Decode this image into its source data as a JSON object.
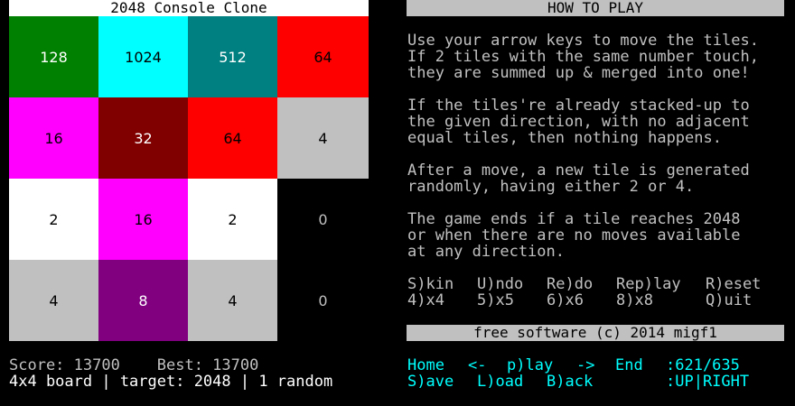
{
  "title": "2048 Console Clone",
  "board": {
    "tiles": [
      {
        "value": "128",
        "bg": "#008000",
        "fg": "#ffffff"
      },
      {
        "value": "1024",
        "bg": "#00ffff",
        "fg": "#000000"
      },
      {
        "value": "512",
        "bg": "#008080",
        "fg": "#ffffff"
      },
      {
        "value": "64",
        "bg": "#ff0000",
        "fg": "#000000"
      },
      {
        "value": "16",
        "bg": "#ff00ff",
        "fg": "#000000"
      },
      {
        "value": "32",
        "bg": "#800000",
        "fg": "#ffffff"
      },
      {
        "value": "64",
        "bg": "#ff0000",
        "fg": "#000000"
      },
      {
        "value": "4",
        "bg": "#c0c0c0",
        "fg": "#000000"
      },
      {
        "value": "2",
        "bg": "#ffffff",
        "fg": "#000000"
      },
      {
        "value": "16",
        "bg": "#ff00ff",
        "fg": "#000000"
      },
      {
        "value": "2",
        "bg": "#ffffff",
        "fg": "#000000"
      },
      {
        "value": "0",
        "bg": "#000000",
        "fg": "#c0c0c0"
      },
      {
        "value": "4",
        "bg": "#c0c0c0",
        "fg": "#000000"
      },
      {
        "value": "8",
        "bg": "#800080",
        "fg": "#ffffff"
      },
      {
        "value": "4",
        "bg": "#c0c0c0",
        "fg": "#000000"
      },
      {
        "value": "0",
        "bg": "#000000",
        "fg": "#c0c0c0"
      }
    ]
  },
  "status": {
    "score_line": "Score: 13700    Best: 13700",
    "info_line": "4x4 board | target: 2048 | 1 random"
  },
  "howto": {
    "header": "HOW TO PLAY",
    "p1": "Use your arrow keys to move the tiles.\nIf 2 tiles with the same number touch,\nthey are summed up & merged into one!",
    "p2": "If the tiles're already stacked-up to\nthe given direction, with no adjacent\nequal tiles, then nothing happens.",
    "p3": "After a move, a new tile is generated\nrandomly, having either 2 or 4.",
    "p4": "The game ends if a tile reaches 2048\nor when there are no moves available\nat any direction."
  },
  "keys": {
    "skin": "S)kin",
    "undo": "U)ndo",
    "redo": "Re)do",
    "replay": "Rep)lay",
    "reset": "R)eset",
    "x4": "4)x4",
    "x5": "5)x5",
    "x6": "6)x6",
    "x8": "8)x8",
    "quit": "Q)uit"
  },
  "footer": "free software (c) 2014 migf1",
  "nav": {
    "home": "Home",
    "back_arrow": "<-",
    "play": "p)lay",
    "fwd_arrow": "->",
    "end": "End",
    "move_counter": ":621/635",
    "save": "S)ave",
    "load": "L)oad",
    "back": "B)ack",
    "last_moves": ":UP|RIGHT"
  }
}
